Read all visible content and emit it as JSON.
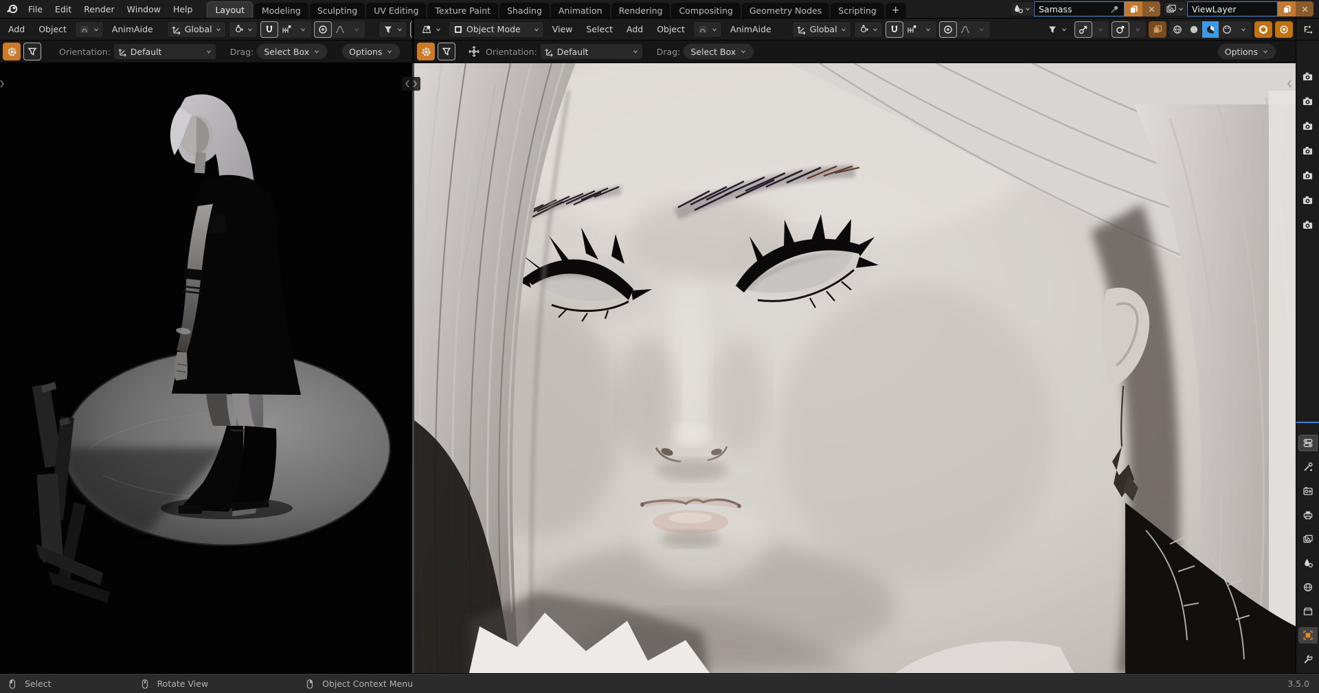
{
  "topbar": {
    "menus": [
      "File",
      "Edit",
      "Render",
      "Window",
      "Help"
    ],
    "tabs": [
      "Layout",
      "Modeling",
      "Sculpting",
      "UV Editing",
      "Texture Paint",
      "Shading",
      "Animation",
      "Rendering",
      "Compositing",
      "Geometry Nodes",
      "Scripting"
    ],
    "active_tab": "Layout",
    "new_tab_label": "+",
    "scene": {
      "value": "Samass"
    },
    "view_layer": {
      "value": "ViewLayer"
    }
  },
  "viewport_header": {
    "left": {
      "menus": [
        "Add",
        "Object",
        "AnimAide"
      ],
      "orientation": "Global"
    },
    "right": {
      "mode": "Object Mode",
      "menus": [
        "View",
        "Select",
        "Add",
        "Object",
        "AnimAide"
      ],
      "orientation": "Global"
    }
  },
  "tool_settings": {
    "orientation_label": "Orientation:",
    "orientation_value": "Default",
    "drag_label": "Drag:",
    "drag_value": "Select Box",
    "options_label": "Options"
  },
  "right_strip": {
    "outliner_camera_count": 7,
    "properties_tabs": [
      "properties-editor",
      "tool",
      "render",
      "output",
      "view-layer",
      "scene",
      "world",
      "collection",
      "object",
      "modifiers"
    ],
    "active_properties_tab": "object"
  },
  "status_bar": {
    "items": [
      {
        "icon": "mouse-left-icon",
        "label": "Select"
      },
      {
        "icon": "mouse-middle-icon",
        "label": "Rotate View"
      },
      {
        "icon": "mouse-right-icon",
        "label": "Object Context Menu"
      }
    ],
    "version": "3.5.0"
  },
  "colors": {
    "accent_orange": "#c2720f",
    "accent_blue": "#4a80d9",
    "material_preview_active": "#3d9ae8",
    "active_tab_bg": "#333333",
    "header_bg": "#1b1b1b",
    "statusbar_bg": "#2b2b2b"
  }
}
